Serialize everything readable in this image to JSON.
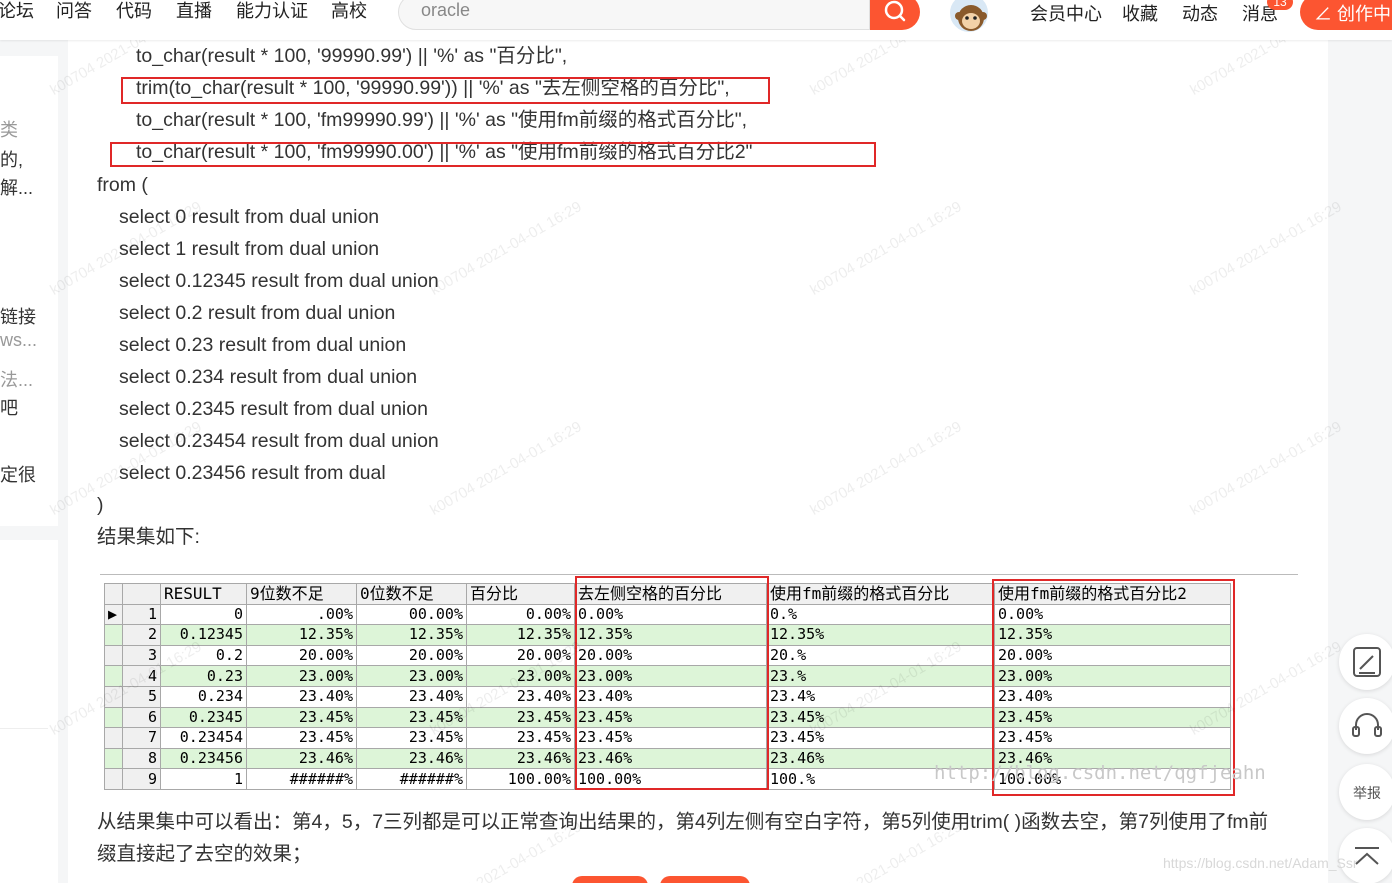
{
  "nav": {
    "items": [
      "论坛",
      "问答",
      "代码",
      "直播",
      "能力认证",
      "高校"
    ],
    "search_text": "oracle",
    "right_items": [
      "会员中心",
      "收藏",
      "动态",
      "消息"
    ],
    "badge": "13",
    "create_label": "创作中"
  },
  "sidebar": {
    "lines": [
      "类",
      "的,",
      "解...",
      "链接",
      "ws...",
      "法...",
      "吧",
      "定很"
    ]
  },
  "article": {
    "code_lines": [
      "to_char(result * 100, '99990.99') || '%' as \"百分比\",",
      "trim(to_char(result * 100, '99990.99')) || '%' as \"去左侧空格的百分比\",",
      "to_char(result * 100, 'fm99990.99') || '%' as \"使用fm前缀的格式百分比\",",
      "to_char(result * 100, 'fm99990.00') || '%' as \"使用fm前缀的格式百分比2\"",
      "from (",
      "select 0 result from dual union",
      "select 1 result from dual union",
      "select 0.12345 result from dual union",
      "select 0.2 result from dual union",
      "select 0.23 result from dual union",
      "select 0.234 result from dual union",
      "select 0.2345 result from dual union",
      "select 0.23454 result from dual union",
      "select 0.23456 result from dual",
      ")"
    ],
    "result_heading": "结果集如下:",
    "conclusion_1": "从结果集中可以看出：第4，5，7三列都是可以正常查询出结果的，第4列左侧有空白字符，第5列使用trim( )函数去空，第7列使用了fm前",
    "conclusion_2": "缀直接起了去空的效果；",
    "watermark_url": "http://blog.csdn.net/qgfjeahn",
    "credit": "https://blog.csdn.net/Adam_Ssr"
  },
  "grid": {
    "headers": [
      "RESULT",
      "9位数不足",
      "0位数不足",
      "百分比",
      "去左侧空格的百分比",
      "使用fm前缀的格式百分比",
      "使用fm前缀的格式百分比2"
    ],
    "rows": [
      [
        "1",
        "0",
        ".00%",
        "00.00%",
        "0.00%",
        "0.00%",
        "0.%",
        "0.00%"
      ],
      [
        "2",
        "0.12345",
        "12.35%",
        "12.35%",
        "12.35%",
        "12.35%",
        "12.35%",
        "12.35%"
      ],
      [
        "3",
        "0.2",
        "20.00%",
        "20.00%",
        "20.00%",
        "20.00%",
        "20.%",
        "20.00%"
      ],
      [
        "4",
        "0.23",
        "23.00%",
        "23.00%",
        "23.00%",
        "23.00%",
        "23.%",
        "23.00%"
      ],
      [
        "5",
        "0.234",
        "23.40%",
        "23.40%",
        "23.40%",
        "23.40%",
        "23.4%",
        "23.40%"
      ],
      [
        "6",
        "0.2345",
        "23.45%",
        "23.45%",
        "23.45%",
        "23.45%",
        "23.45%",
        "23.45%"
      ],
      [
        "7",
        "0.23454",
        "23.45%",
        "23.45%",
        "23.45%",
        "23.45%",
        "23.45%",
        "23.45%"
      ],
      [
        "8",
        "0.23456",
        "23.46%",
        "23.46%",
        "23.46%",
        "23.46%",
        "23.46%",
        "23.46%"
      ],
      [
        "9",
        "1",
        "######%",
        "######%",
        "100.00%",
        "100.00%",
        "100.%",
        "100.00%"
      ]
    ]
  },
  "tools": {
    "report_label": "举报"
  },
  "watermark": "k00704 2021-04-01 16:29",
  "colors": {
    "accent": "#fc5531",
    "highlight_box": "#e02828",
    "alt_row": "#ddf5d8"
  }
}
